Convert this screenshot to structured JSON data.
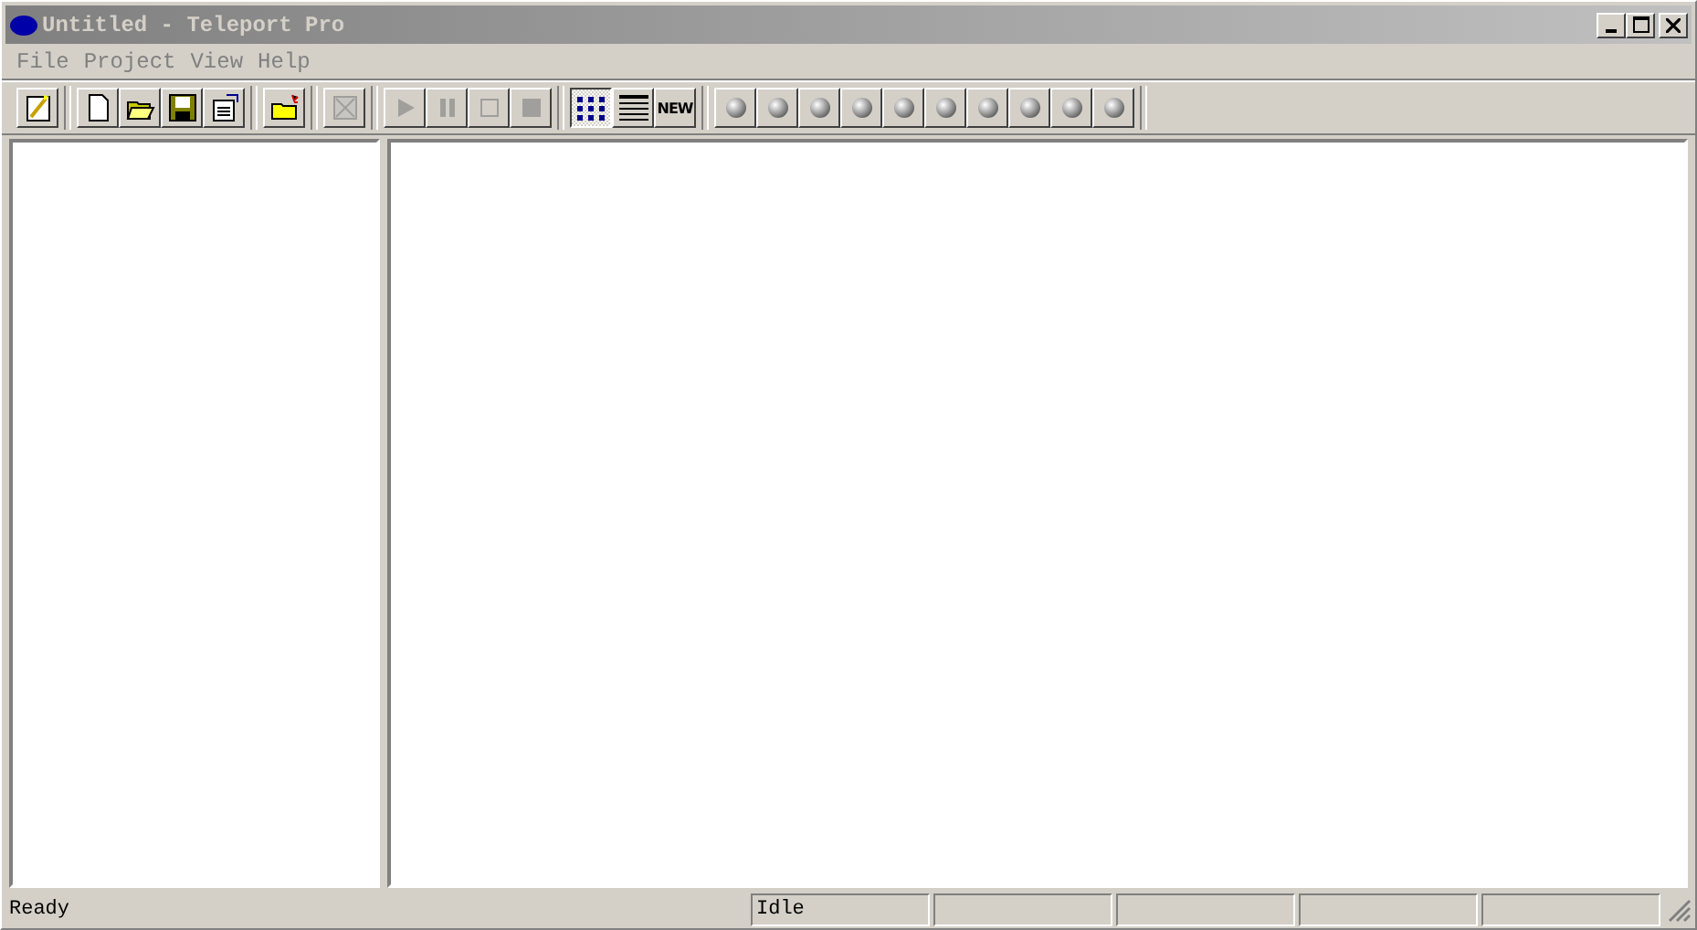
{
  "window": {
    "title": "Untitled - Teleport Pro",
    "active": false
  },
  "menu": [
    {
      "label": "File"
    },
    {
      "label": "Project"
    },
    {
      "label": "View"
    },
    {
      "label": "Help"
    }
  ],
  "toolbar": [
    [
      {
        "kind": "wizard",
        "disabled": false,
        "selected": false
      }
    ],
    [
      {
        "kind": "new",
        "disabled": false,
        "selected": false
      },
      {
        "kind": "open",
        "disabled": false,
        "selected": false
      },
      {
        "kind": "save",
        "disabled": false,
        "selected": false
      },
      {
        "kind": "properties",
        "disabled": false,
        "selected": false
      }
    ],
    [
      {
        "kind": "folder",
        "disabled": false,
        "selected": false
      }
    ],
    [
      {
        "kind": "browse",
        "disabled": true,
        "selected": false
      }
    ],
    [
      {
        "kind": "play",
        "disabled": true,
        "selected": false
      },
      {
        "kind": "pause",
        "disabled": true,
        "selected": false
      },
      {
        "kind": "stop",
        "disabled": true,
        "selected": false
      },
      {
        "kind": "halt",
        "disabled": true,
        "selected": false
      }
    ],
    [
      {
        "kind": "tree",
        "disabled": false,
        "selected": true
      },
      {
        "kind": "list",
        "disabled": false,
        "selected": false
      },
      {
        "kind": "new-badge",
        "disabled": false,
        "selected": false,
        "text": "NEW"
      }
    ],
    [
      {
        "kind": "ball",
        "disabled": false,
        "selected": false
      },
      {
        "kind": "ball",
        "disabled": false,
        "selected": false
      },
      {
        "kind": "ball",
        "disabled": false,
        "selected": false
      },
      {
        "kind": "ball",
        "disabled": false,
        "selected": false
      },
      {
        "kind": "ball",
        "disabled": false,
        "selected": false
      },
      {
        "kind": "ball",
        "disabled": false,
        "selected": false
      },
      {
        "kind": "ball",
        "disabled": false,
        "selected": false
      },
      {
        "kind": "ball",
        "disabled": false,
        "selected": false
      },
      {
        "kind": "ball",
        "disabled": false,
        "selected": false
      },
      {
        "kind": "ball",
        "disabled": false,
        "selected": false
      }
    ]
  ],
  "status_bar": {
    "message": "Ready",
    "panels": [
      "Idle"
    ]
  }
}
